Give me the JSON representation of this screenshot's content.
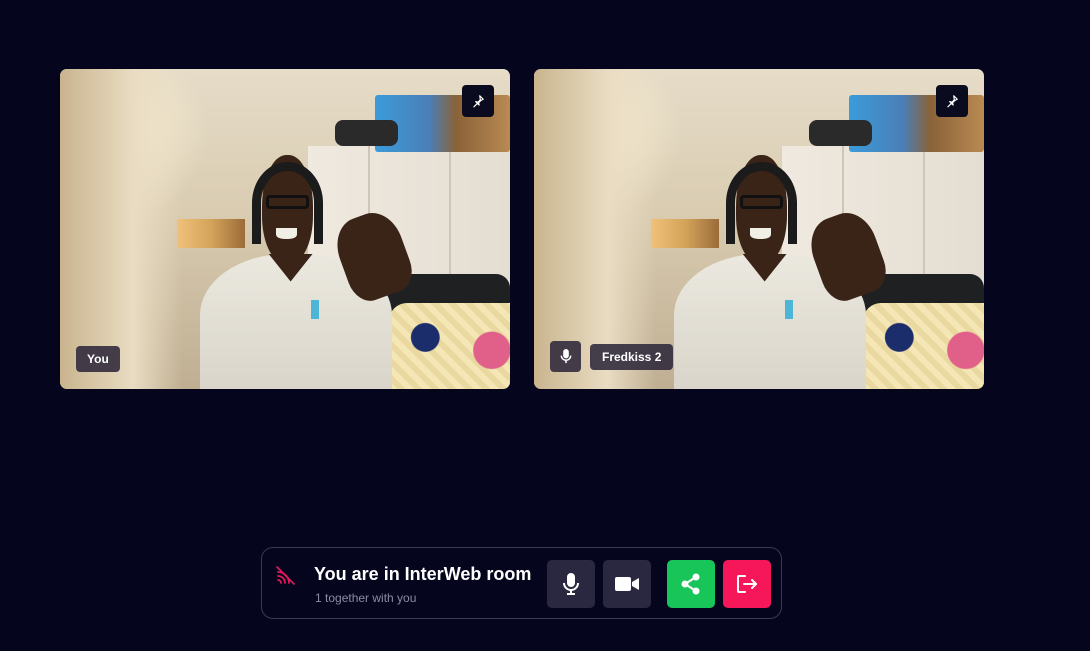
{
  "participants": [
    {
      "name": "You",
      "icons": {
        "pin": "pin-icon"
      }
    },
    {
      "name": "Fredkiss 2",
      "icons": {
        "pin": "pin-icon",
        "audio": "microphone-icon"
      }
    }
  ],
  "room": {
    "title": "You are in InterWeb room",
    "subtitle": "1 together with you",
    "status_icon": "signal-icon"
  },
  "controls": {
    "mic_icon": "microphone-icon",
    "camera_icon": "video-camera-icon",
    "share_icon": "share-icon",
    "leave_icon": "leave-icon"
  },
  "colors": {
    "background": "#05061e",
    "share": "#18c558",
    "leave": "#f5175a",
    "signal": "#e01a5a",
    "control_dark": "#2a2840"
  }
}
